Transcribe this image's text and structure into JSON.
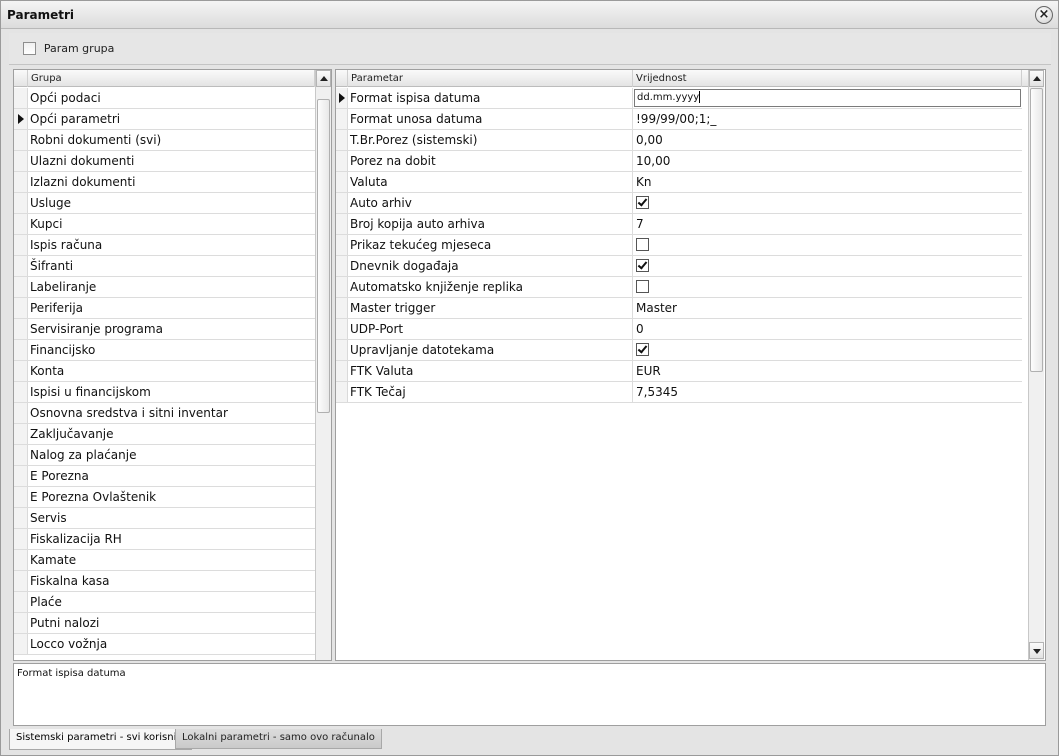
{
  "window": {
    "title": "Parametri",
    "close_glyph": "×"
  },
  "toolbar": {
    "param_grupa_label": "Param grupa",
    "param_grupa_checked": false
  },
  "groups": {
    "header": "Grupa",
    "selected_index": 1,
    "items": [
      "Opći podaci",
      "Opći parametri",
      "Robni dokumenti (svi)",
      "Ulazni dokumenti",
      "Izlazni dokumenti",
      "Usluge",
      "Kupci",
      "Ispis računa",
      "Šifranti",
      "Labeliranje",
      "Periferija",
      "Servisiranje programa",
      "Financijsko",
      "Konta",
      "Ispisi u financijskom",
      "Osnovna sredstva i sitni inventar",
      "Zaključavanje",
      "Nalog za plaćanje",
      "E Porezna",
      "E Porezna Ovlaštenik",
      "Servis",
      "Fiskalizacija RH",
      "Kamate",
      "Fiskalna kasa",
      "Plaće",
      "Putni nalozi",
      "Locco vožnja"
    ]
  },
  "params": {
    "header_param": "Parametar",
    "header_value": "Vrijednost",
    "selected_index": 0,
    "rows": [
      {
        "name": "Format ispisa datuma",
        "value": "dd.mm.yyyy",
        "type": "edit"
      },
      {
        "name": "Format unosa datuma",
        "value": "!99/99/00;1;_",
        "type": "text"
      },
      {
        "name": "T.Br.Porez (sistemski)",
        "value": "0,00",
        "type": "text"
      },
      {
        "name": "Porez na dobit",
        "value": "10,00",
        "type": "text"
      },
      {
        "name": "Valuta",
        "value": "Kn",
        "type": "text"
      },
      {
        "name": "Auto arhiv",
        "value": "",
        "type": "check",
        "checked": true
      },
      {
        "name": "Broj kopija auto arhiva",
        "value": "7",
        "type": "text"
      },
      {
        "name": "Prikaz tekućeg mjeseca",
        "value": "",
        "type": "check",
        "checked": false
      },
      {
        "name": "Dnevnik događaja",
        "value": "",
        "type": "check",
        "checked": true
      },
      {
        "name": "Automatsko knjiženje replika",
        "value": "",
        "type": "check",
        "checked": false
      },
      {
        "name": "Master trigger",
        "value": "Master",
        "type": "text"
      },
      {
        "name": "UDP-Port",
        "value": "0",
        "type": "text"
      },
      {
        "name": "Upravljanje datotekama",
        "value": "",
        "type": "check",
        "checked": true
      },
      {
        "name": "FTK Valuta",
        "value": "EUR",
        "type": "text"
      },
      {
        "name": "FTK Tečaj",
        "value": "7,5345",
        "type": "text"
      }
    ]
  },
  "description": {
    "text": "Format ispisa datuma"
  },
  "tabs": [
    {
      "label": "Sistemski parametri - svi korisnici",
      "active": true
    },
    {
      "label": "Lokalni parametri - samo ovo računalo",
      "active": false
    }
  ],
  "icons": {
    "close": "close-icon",
    "row_pointer": "row-pointer-icon",
    "scroll_up": "scroll-up-icon",
    "scroll_down": "scroll-down-icon",
    "check": "check-icon"
  }
}
